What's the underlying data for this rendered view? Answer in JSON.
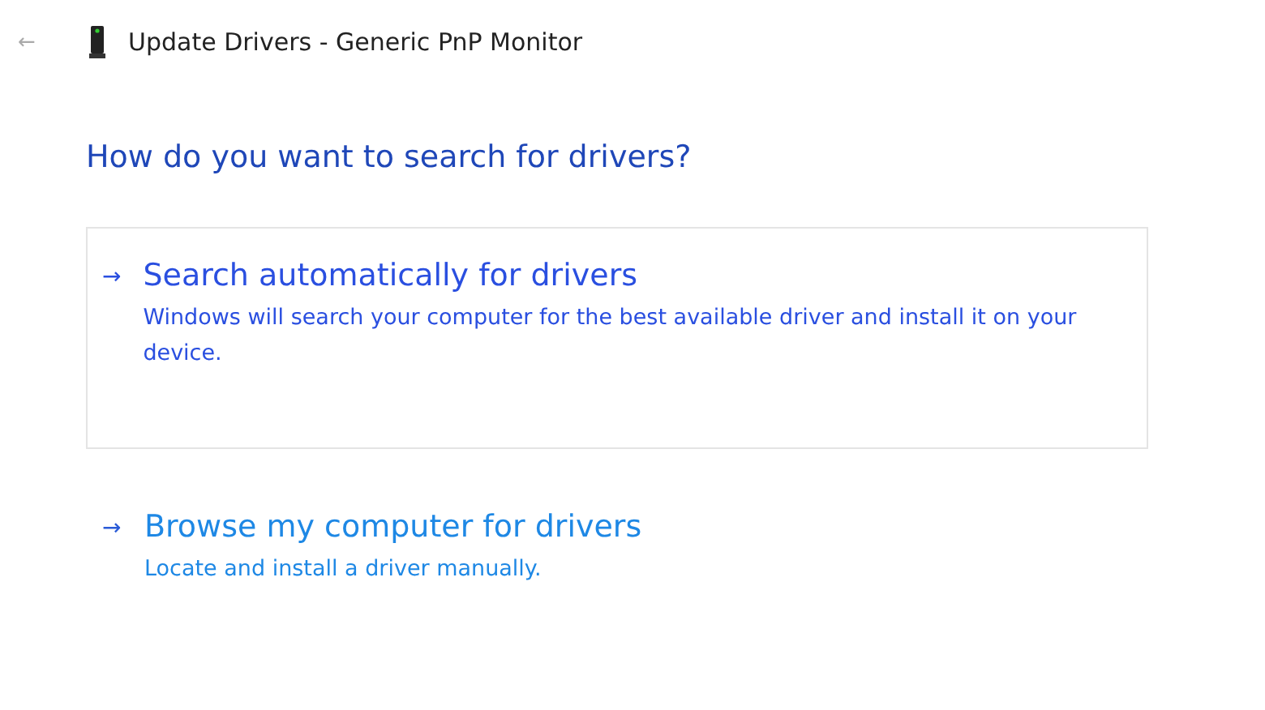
{
  "window": {
    "back": "←",
    "title": "Update Drivers - Generic PnP Monitor"
  },
  "heading": "How do you want to search for drivers?",
  "options": [
    {
      "arrow": "→",
      "title": "Search automatically for drivers",
      "description": "Windows will search your computer for the best available driver and install it on your device.",
      "selected": true
    },
    {
      "arrow": "→",
      "title": "Browse my computer for drivers",
      "description": "Locate and install a driver manually.",
      "selected": false
    }
  ]
}
